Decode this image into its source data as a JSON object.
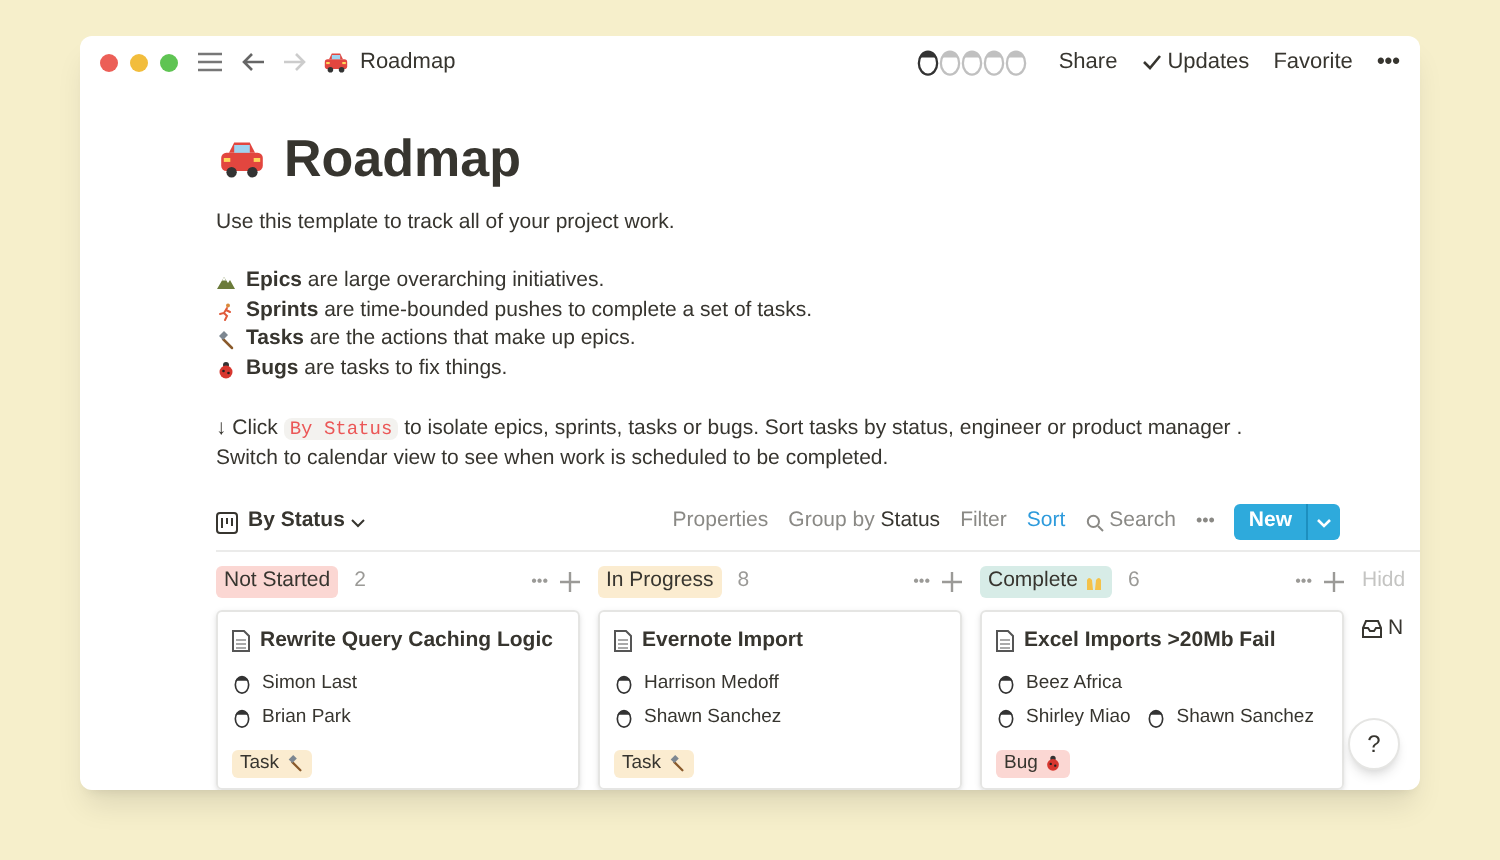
{
  "topbar": {
    "title": "Roadmap",
    "actions": [
      "Share",
      "Updates",
      "Favorite"
    ],
    "more": "•••"
  },
  "page": {
    "title": "Roadmap",
    "intro": "Use this template to track all of your project work.",
    "bullets": [
      {
        "kind": "mountain",
        "text": "**Epics** are large overarching initiatives."
      },
      {
        "kind": "runner",
        "text": "**Sprints** are time-bounded pushes to complete a set of tasks."
      },
      {
        "kind": "hammer",
        "text": "**Tasks** are the actions that make up epics."
      },
      {
        "kind": "bug",
        "text": "**Bugs** are tasks to fix things."
      }
    ],
    "hint": {
      "lead": "↓ Click",
      "code": "By Status",
      "rest": "to isolate epics, sprints, tasks or bugs. Sort tasks by status, engineer or product manager . Switch to calendar view to see when work is scheduled to be completed."
    }
  },
  "view": {
    "name": "By Status",
    "properties": "Properties",
    "group_label": "Group by",
    "group_value": "Status",
    "filter": "Filter",
    "sort": "Sort",
    "search": "Search",
    "more": "•••",
    "new": "New"
  },
  "columns": [
    {
      "label": "Not Started",
      "color": "#fbd7d3",
      "count": "2",
      "cards": [
        {
          "title": "Rewrite Query Caching Logic",
          "people": [
            [
              "Simon Last"
            ],
            [
              "Brian Park"
            ]
          ],
          "tag": {
            "label": "Task",
            "kind": "hammer",
            "color": "#fbecd0"
          }
        }
      ]
    },
    {
      "label": "In Progress",
      "color": "#fbecd0",
      "count": "8",
      "cards": [
        {
          "title": "Evernote Import",
          "people": [
            [
              "Harrison Medoff"
            ],
            [
              "Shawn Sanchez"
            ]
          ],
          "tag": {
            "label": "Task",
            "kind": "hammer",
            "color": "#fbecd0"
          }
        }
      ]
    },
    {
      "label": "Complete",
      "color": "#d7ece7",
      "kind": "hands",
      "count": "6",
      "cards": [
        {
          "title": "Excel Imports >20Mb Fail",
          "people": [
            [
              "Beez Africa"
            ],
            [
              "Shirley Miao",
              "Shawn Sanchez"
            ]
          ],
          "tag": {
            "label": "Bug",
            "kind": "bug",
            "color": "#fbd7d3"
          }
        }
      ]
    }
  ],
  "hidden": {
    "label": "Hidd",
    "item": "N"
  },
  "help": "?"
}
